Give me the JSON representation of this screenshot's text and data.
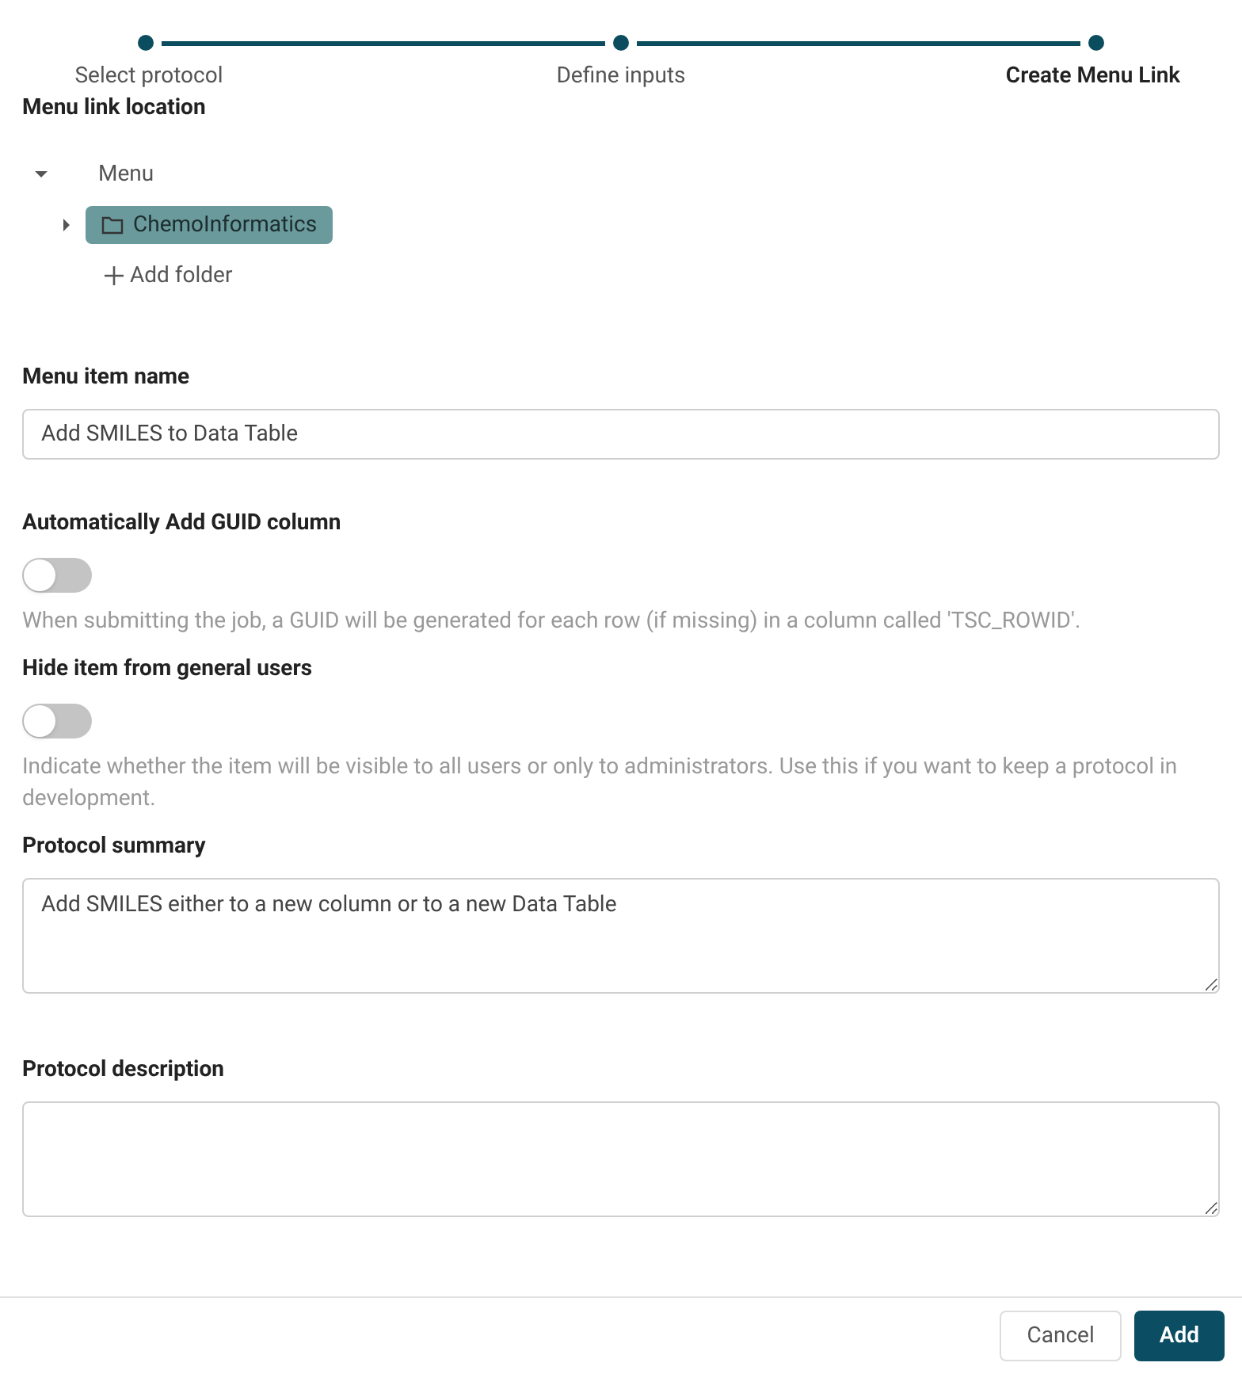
{
  "stepper": {
    "steps": [
      {
        "label": "Select protocol",
        "selected": false
      },
      {
        "label": "Define inputs",
        "selected": false
      },
      {
        "label": "Create Menu Link",
        "selected": true
      }
    ]
  },
  "menu_link_location": {
    "label": "Menu link location",
    "tree": [
      {
        "label": "Menu",
        "expanded": true,
        "selected": false,
        "children": [
          {
            "label": "ChemoInformatics",
            "expanded": false,
            "selected": true
          }
        ]
      }
    ],
    "add_folder": "Add folder"
  },
  "menu_item_name": {
    "label": "Menu item name",
    "value": "Add SMILES to Data Table"
  },
  "toggles": [
    {
      "label": "Automatically Add GUID column",
      "on": false,
      "help": "When submitting the job, a GUID will be generated for each row (if missing) in a column called 'TSC_ROWID'."
    },
    {
      "label": "Hide item from general users",
      "on": false,
      "help": "Indicate whether the item will be visible to all users or only to administrators. Use this if you want to keep a protocol in development."
    }
  ],
  "protocol_summary": {
    "label": "Protocol summary",
    "value": "Add SMILES either to a new column or to a new Data Table"
  },
  "protocol_description": {
    "label": "Protocol description"
  },
  "buttons": {
    "cancel": "Cancel",
    "add": "Add"
  }
}
